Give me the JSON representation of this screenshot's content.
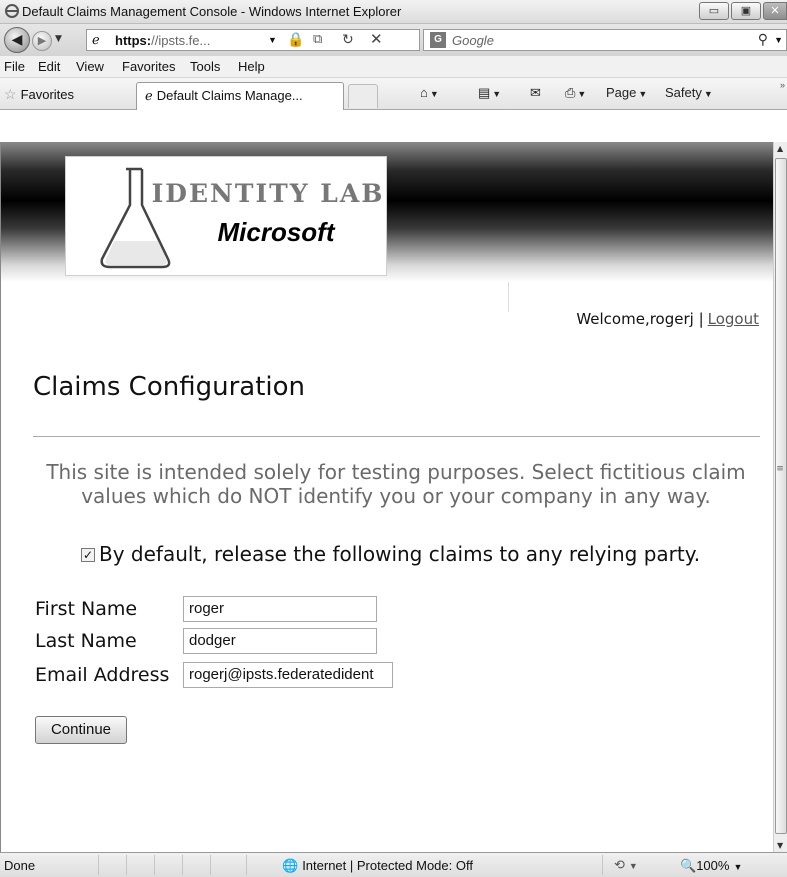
{
  "window": {
    "title": "Default Claims Management Console - Windows Internet Explorer",
    "minimize_glyph": "▭",
    "maximize_glyph": "▣",
    "close_glyph": "✕"
  },
  "addressbar": {
    "url_bold": "https:",
    "url_rest": "//ipsts.fe...",
    "search_placeholder": "Google",
    "search_engine_glyph": "G"
  },
  "menu": [
    "File",
    "Edit",
    "View",
    "Favorites",
    "Tools",
    "Help"
  ],
  "commandbar": {
    "favorites_label": "Favorites",
    "tab_title": "Default Claims Manage...",
    "page_label": "Page",
    "safety_label": "Safety"
  },
  "header": {
    "logo_line1": "IDENTITY LAB",
    "logo_line2": "Microsoft"
  },
  "welcome": {
    "text": "Welcome,rogerj |",
    "logout_label": "Logout"
  },
  "page": {
    "title": "Claims Configuration",
    "notice": "This site is intended solely for testing purposes. Select fictitious claim values which do NOT identify you or your company in any way.",
    "release_label": "By default, release the following claims to any relying party.",
    "release_checked": true
  },
  "form": {
    "first_name_label": "First Name",
    "first_name_value": "roger",
    "last_name_label": "Last Name",
    "last_name_value": "dodger",
    "email_label": "Email Address",
    "email_value": "rogerj@ipsts.federatedident",
    "continue_label": "Continue"
  },
  "statusbar": {
    "status_text": "Done",
    "zone_text": "Internet | Protected Mode: Off",
    "zoom_text": "100%"
  },
  "icons": {
    "back": "back-arrow-icon",
    "forward": "forward-arrow-icon",
    "favorites": "star-icon",
    "home": "home-icon",
    "feeds": "rss-icon",
    "print": "printer-icon",
    "search": "search-icon",
    "globe": "globe-icon"
  },
  "colors": {
    "header_dark": "#000000",
    "notice_text": "#6a6a6a",
    "link": "#555555"
  }
}
